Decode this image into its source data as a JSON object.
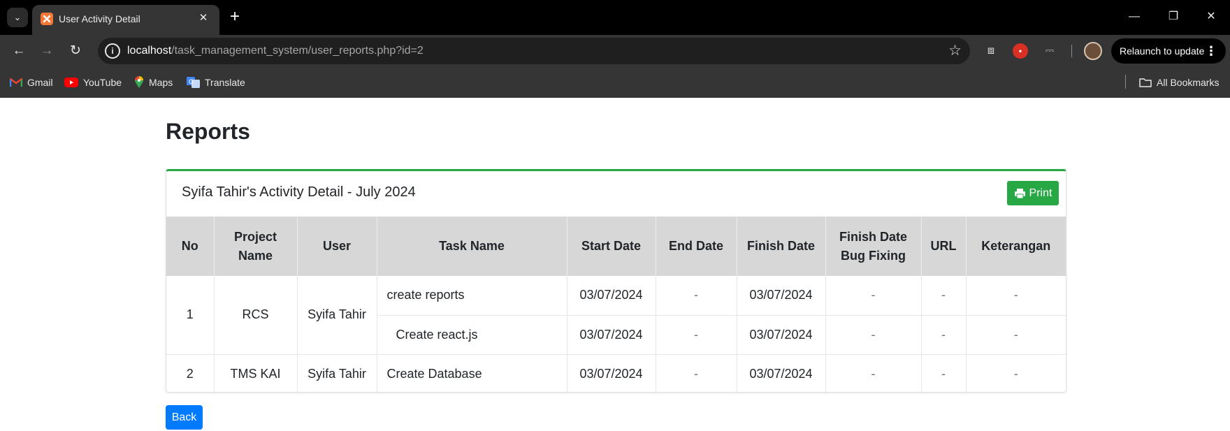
{
  "browser": {
    "tab_title": "User Activity Detail",
    "url_host": "localhost",
    "url_path": "/task_management_system/user_reports.php?id=2",
    "relaunch_label": "Relaunch to update",
    "bookmarks": [
      {
        "label": "Gmail",
        "icon": "gmail-icon"
      },
      {
        "label": "YouTube",
        "icon": "youtube-icon"
      },
      {
        "label": "Maps",
        "icon": "maps-icon"
      },
      {
        "label": "Translate",
        "icon": "translate-icon"
      }
    ],
    "all_bookmarks_label": "All Bookmarks"
  },
  "page": {
    "title": "Reports",
    "card_title": "Syifa Tahir's Activity Detail - July 2024",
    "print_label": "Print",
    "back_label": "Back"
  },
  "table": {
    "headers": {
      "no": "No",
      "project_line1": "Project",
      "project_line2": "Name",
      "user": "User",
      "task": "Task Name",
      "start": "Start Date",
      "end": "End Date",
      "finish": "Finish Date",
      "bug_line1": "Finish Date",
      "bug_line2": "Bug Fixing",
      "url": "URL",
      "keterangan": "Keterangan"
    },
    "rows": [
      {
        "no": "1",
        "project": "RCS",
        "user": "Syifa Tahir",
        "tasks": [
          {
            "task": "create reports",
            "start": "03/07/2024",
            "end": "-",
            "finish": "03/07/2024",
            "bug": "-",
            "url": "-",
            "keterangan": "-"
          },
          {
            "task": "Create react.js",
            "start": "03/07/2024",
            "end": "-",
            "finish": "03/07/2024",
            "bug": "-",
            "url": "-",
            "keterangan": "-"
          }
        ]
      },
      {
        "no": "2",
        "project": "TMS KAI",
        "user": "Syifa Tahir",
        "tasks": [
          {
            "task": "Create Database",
            "start": "03/07/2024",
            "end": "-",
            "finish": "03/07/2024",
            "bug": "-",
            "url": "-",
            "keterangan": "-"
          }
        ]
      }
    ]
  },
  "colors": {
    "card_accent": "#28a745",
    "print_button": "#28a745",
    "back_button": "#007bff",
    "table_header_bg": "#d7d7d7"
  }
}
